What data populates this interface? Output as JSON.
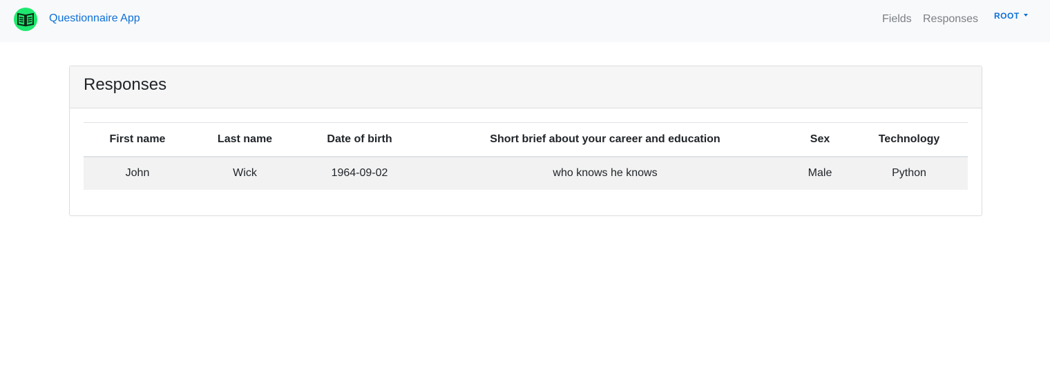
{
  "app": {
    "brand_name": "Questionnaire App",
    "logo_icon": "book-icon",
    "accent_color": "#0d6fd8",
    "logo_color": "#1ee86f"
  },
  "nav": {
    "fields_label": "Fields",
    "responses_label": "Responses",
    "user_label": "ROOT"
  },
  "page": {
    "title": "Responses"
  },
  "table": {
    "columns": [
      "First name",
      "Last name",
      "Date of birth",
      "Short brief about your career and education",
      "Sex",
      "Technology"
    ],
    "rows": [
      [
        "John",
        "Wick",
        "1964-09-02",
        "who knows he knows",
        "Male",
        "Python"
      ]
    ]
  }
}
